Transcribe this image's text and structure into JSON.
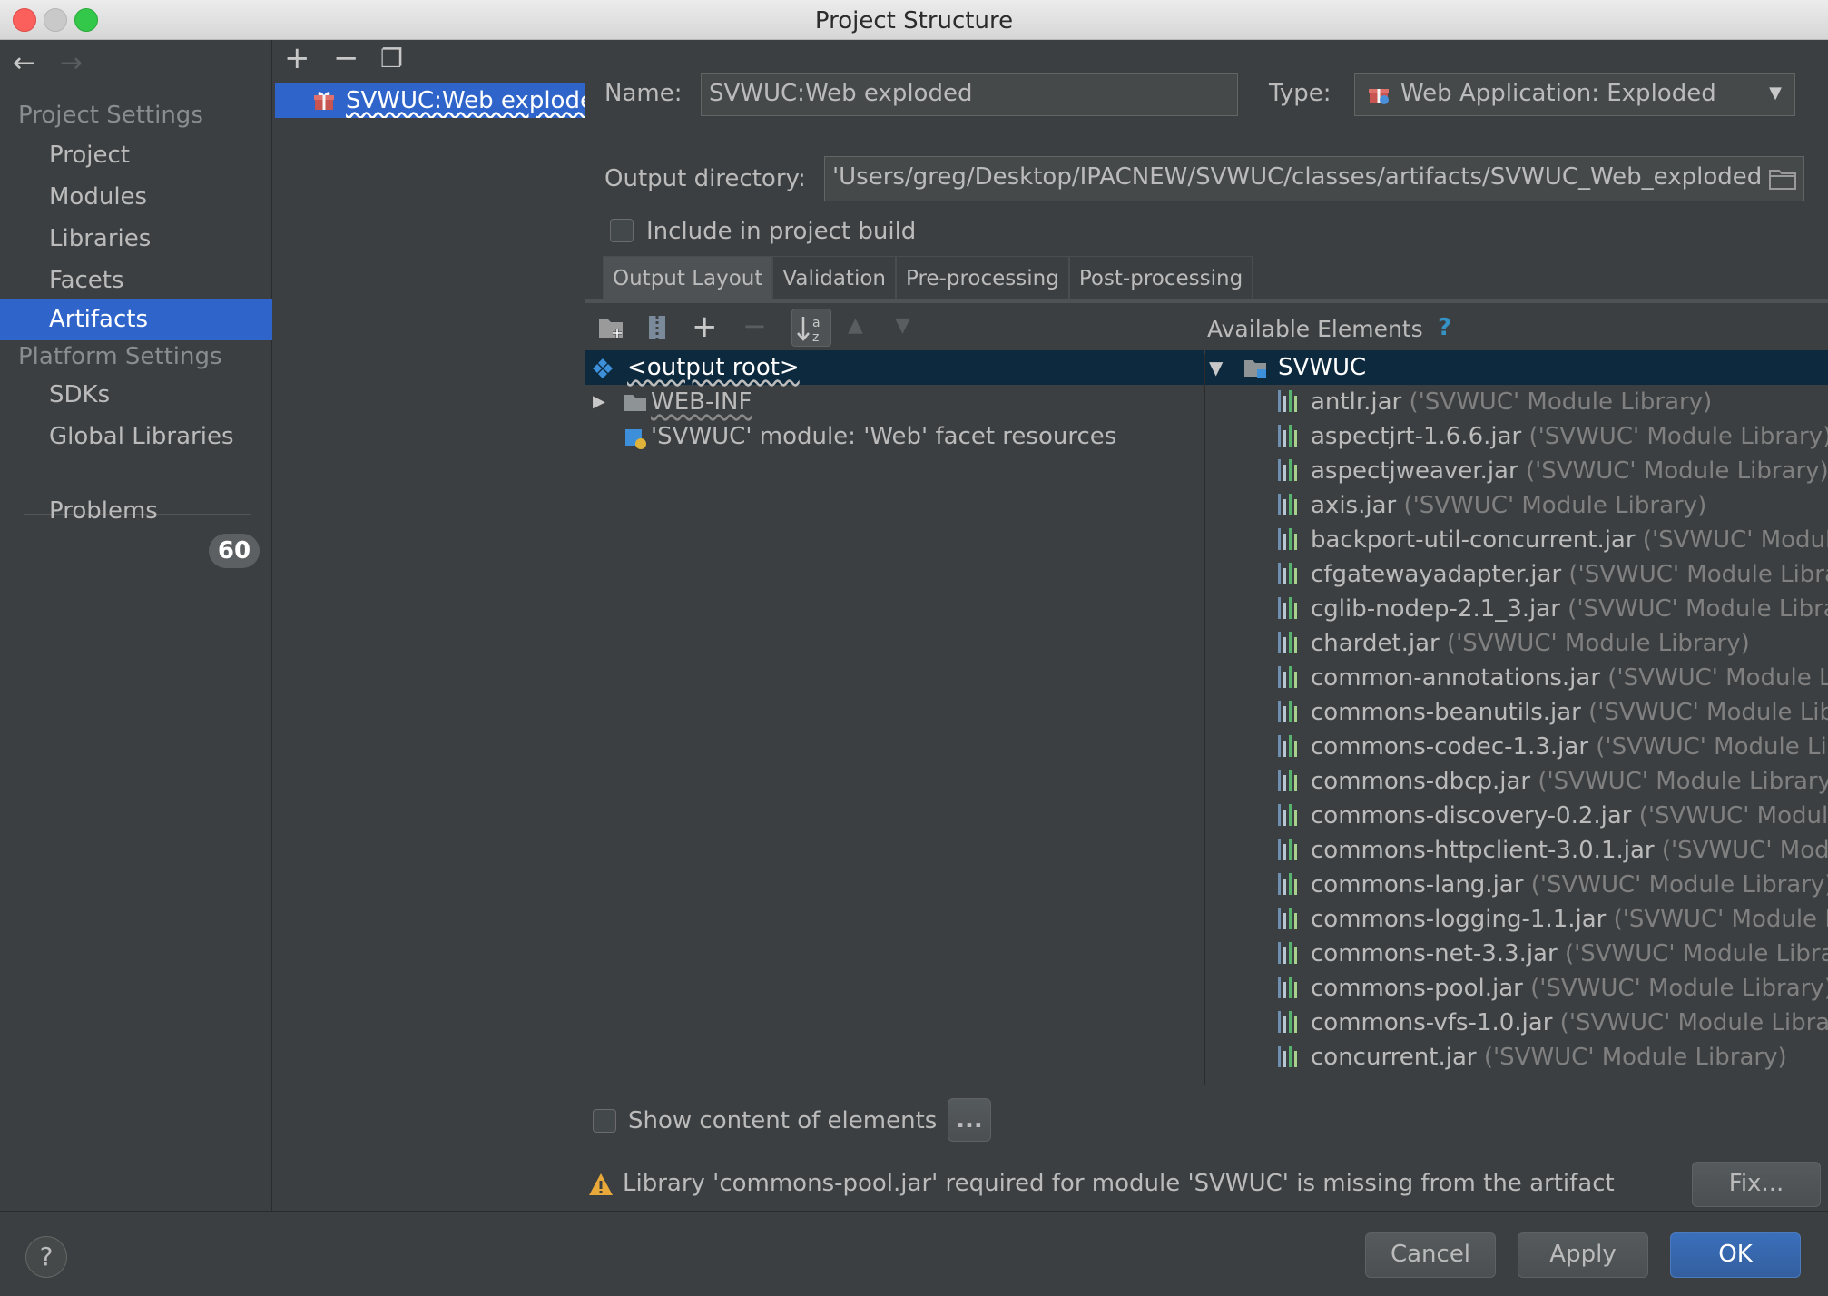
{
  "window": {
    "title": "Project Structure"
  },
  "nav": {
    "back": "←",
    "forward": "→",
    "project_settings_header": "Project Settings",
    "project_items": [
      "Project",
      "Modules",
      "Libraries",
      "Facets",
      "Artifacts"
    ],
    "platform_settings_header": "Platform Settings",
    "platform_items": [
      "SDKs",
      "Global Libraries"
    ],
    "problems_label": "Problems",
    "problems_count": "60"
  },
  "artifact_list": {
    "add": "+",
    "remove": "−",
    "copy": "❐",
    "selected_item": "SVWUC:Web exploded"
  },
  "main": {
    "name_label": "Name:",
    "name_value": "SVWUC:Web exploded",
    "type_label": "Type:",
    "type_value": "Web Application: Exploded",
    "output_dir_label": "Output directory:",
    "output_dir_value": "'Users/greg/Desktop/IPACNEW/SVWUC/classes/artifacts/SVWUC_Web_exploded",
    "include_build_label": "Include in project build",
    "tabs": [
      "Output Layout",
      "Validation",
      "Pre-processing",
      "Post-processing"
    ]
  },
  "layout_tree": {
    "rows": [
      {
        "label": "<output root>"
      },
      {
        "label": "WEB-INF"
      },
      {
        "label": "'SVWUC' module: 'Web' facet resources"
      }
    ]
  },
  "available": {
    "header": "Available Elements",
    "help": "?",
    "root": "SVWUC",
    "libs": [
      {
        "name": "antlr.jar",
        "desc": "('SVWUC' Module Library)"
      },
      {
        "name": "aspectjrt-1.6.6.jar",
        "desc": "('SVWUC' Module Library)"
      },
      {
        "name": "aspectjweaver.jar",
        "desc": "('SVWUC' Module Library)"
      },
      {
        "name": "axis.jar",
        "desc": "('SVWUC' Module Library)"
      },
      {
        "name": "backport-util-concurrent.jar",
        "desc": "('SVWUC' Module"
      },
      {
        "name": "cfgatewayadapter.jar",
        "desc": "('SVWUC' Module Library"
      },
      {
        "name": "cglib-nodep-2.1_3.jar",
        "desc": "('SVWUC' Module Libra"
      },
      {
        "name": "chardet.jar",
        "desc": "('SVWUC' Module Library)"
      },
      {
        "name": "common-annotations.jar",
        "desc": "('SVWUC' Module Lib"
      },
      {
        "name": "commons-beanutils.jar",
        "desc": "('SVWUC' Module Libr"
      },
      {
        "name": "commons-codec-1.3.jar",
        "desc": "('SVWUC' Module Lib"
      },
      {
        "name": "commons-dbcp.jar",
        "desc": "('SVWUC' Module Library)"
      },
      {
        "name": "commons-discovery-0.2.jar",
        "desc": "('SVWUC' Module"
      },
      {
        "name": "commons-httpclient-3.0.1.jar",
        "desc": "('SVWUC' Modu"
      },
      {
        "name": "commons-lang.jar",
        "desc": "('SVWUC' Module Library)"
      },
      {
        "name": "commons-logging-1.1.jar",
        "desc": "('SVWUC' Module L"
      },
      {
        "name": "commons-net-3.3.jar",
        "desc": "('SVWUC' Module Librar"
      },
      {
        "name": "commons-pool.jar",
        "desc": "('SVWUC' Module Library)"
      },
      {
        "name": "commons-vfs-1.0.jar",
        "desc": "('SVWUC' Module Librar"
      },
      {
        "name": "concurrent.jar",
        "desc": "('SVWUC' Module Library)"
      }
    ]
  },
  "footer": {
    "show_content_label": "Show content of elements",
    "more_button": "...",
    "warning_text": "Library 'commons-pool.jar' required for module 'SVWUC' is missing from the artifact",
    "fix_button": "Fix...",
    "help": "?",
    "cancel": "Cancel",
    "apply": "Apply",
    "ok": "OK"
  },
  "colors": {
    "selection": "#2f65ca",
    "tree_selection": "#0d293e",
    "background": "#3c3f41",
    "primary_button": "#365f9f",
    "warning": "#e8a93a"
  }
}
